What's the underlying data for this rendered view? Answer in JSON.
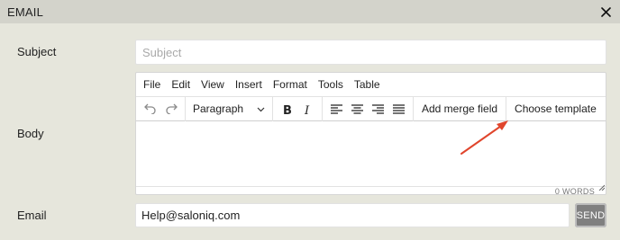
{
  "dialog": {
    "title": "EMAIL",
    "close_icon": "close-icon"
  },
  "form": {
    "subject_label": "Subject",
    "subject_placeholder": "Subject",
    "subject_value": "",
    "body_label": "Body",
    "email_label": "Email",
    "email_value": "Help@saloniq.com",
    "send_label": "SEND"
  },
  "editor": {
    "menu": [
      "File",
      "Edit",
      "View",
      "Insert",
      "Format",
      "Tools",
      "Table"
    ],
    "block_format": "Paragraph",
    "add_merge_field_label": "Add merge field",
    "choose_template_label": "Choose template",
    "word_count": "0 WORDS",
    "icons": [
      "undo-icon",
      "redo-icon",
      "bold-icon",
      "italic-icon",
      "align-left-icon",
      "align-center-icon",
      "align-right-icon",
      "align-justify-icon"
    ]
  },
  "colors": {
    "annotation_arrow": "#e0452c",
    "send_button": "#808080",
    "header_bg": "#d3d3cb",
    "panel_bg": "#e6e6dc"
  }
}
